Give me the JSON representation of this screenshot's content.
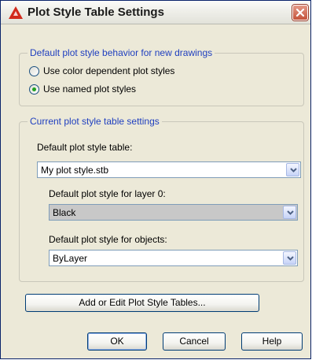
{
  "window": {
    "title": "Plot Style Table Settings"
  },
  "behavior_group": {
    "legend": "Default plot style behavior for new drawings",
    "options": [
      {
        "label": "Use color dependent plot styles",
        "checked": false
      },
      {
        "label": "Use named plot styles",
        "checked": true
      }
    ]
  },
  "table_group": {
    "legend": "Current plot style table settings",
    "table_label": "Default plot style table:",
    "table_value": "My plot style.stb",
    "layer0_label": "Default plot style for layer 0:",
    "layer0_value": "Black",
    "objects_label": "Default plot style for objects:",
    "objects_value": "ByLayer"
  },
  "buttons": {
    "add_edit": "Add or Edit Plot Style Tables...",
    "ok": "OK",
    "cancel": "Cancel",
    "help": "Help"
  }
}
